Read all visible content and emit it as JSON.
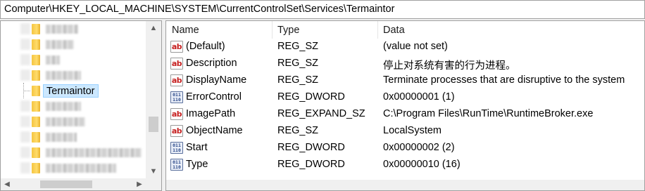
{
  "address_bar": {
    "path": "Computer\\HKEY_LOCAL_MACHINE\\SYSTEM\\CurrentControlSet\\Services\\Termaintor"
  },
  "tree": {
    "selected_label": "Termaintor",
    "scroll_up_glyph": "▲",
    "scroll_down_glyph": "▼",
    "scroll_left_glyph": "◀",
    "scroll_right_glyph": "▶"
  },
  "values_list": {
    "columns": {
      "name": "Name",
      "type": "Type",
      "data": "Data"
    },
    "rows": [
      {
        "icon": "string-value-icon",
        "name": "(Default)",
        "type": "REG_SZ",
        "data": "(value not set)"
      },
      {
        "icon": "string-value-icon",
        "name": "Description",
        "type": "REG_SZ",
        "data": "停止对系统有害的行为进程。"
      },
      {
        "icon": "string-value-icon",
        "name": "DisplayName",
        "type": "REG_SZ",
        "data": "Terminate processes that are disruptive to the system"
      },
      {
        "icon": "binary-value-icon",
        "name": "ErrorControl",
        "type": "REG_DWORD",
        "data": "0x00000001 (1)"
      },
      {
        "icon": "string-value-icon",
        "name": "ImagePath",
        "type": "REG_EXPAND_SZ",
        "data": "C:\\Program Files\\RunTime\\RuntimeBroker.exe"
      },
      {
        "icon": "string-value-icon",
        "name": "ObjectName",
        "type": "REG_SZ",
        "data": "LocalSystem"
      },
      {
        "icon": "binary-value-icon",
        "name": "Start",
        "type": "REG_DWORD",
        "data": "0x00000002 (2)"
      },
      {
        "icon": "binary-value-icon",
        "name": "Type",
        "type": "REG_DWORD",
        "data": "0x00000010 (16)"
      }
    ],
    "icon_glyphs": {
      "string": "ab",
      "binary": "011\n110"
    }
  },
  "colors": {
    "selection_bg": "#cce8ff",
    "string_icon_text": "#c62020",
    "binary_icon_text": "#2d4a8a"
  }
}
